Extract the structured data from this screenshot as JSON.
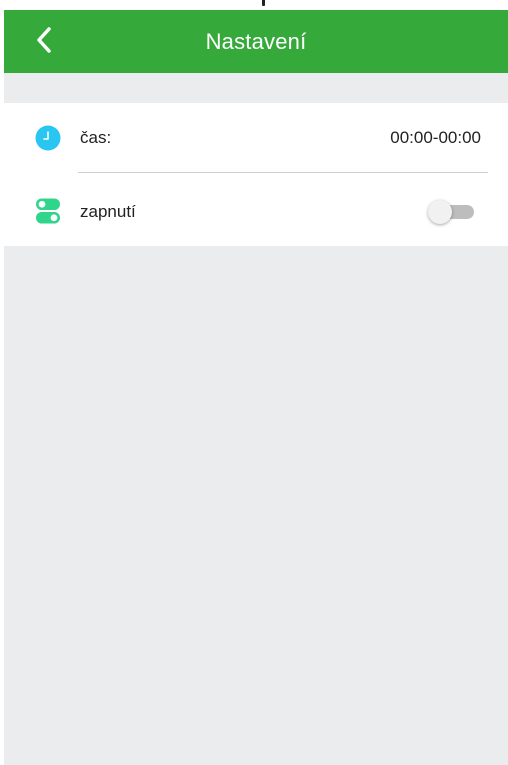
{
  "header": {
    "title": "Nastavení",
    "back_icon": "chevron-left-icon",
    "background_color": "#36a93b"
  },
  "settings": {
    "items": [
      {
        "icon": "clock-icon",
        "icon_color": "#29c6f2",
        "label": "čas:",
        "value": "00:00-00:00"
      },
      {
        "icon": "toggle-switch-icon",
        "icon_color": "#2fd58a",
        "label": "zapnutí",
        "toggle_state": "off"
      }
    ]
  }
}
